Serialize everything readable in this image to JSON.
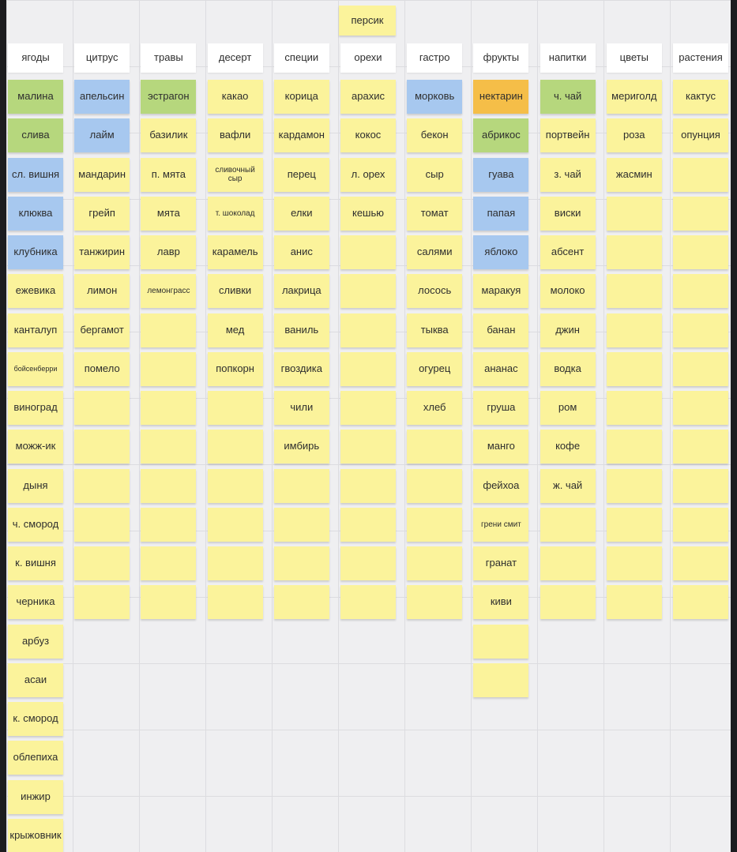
{
  "colors": {
    "yellow": "#fbf39b",
    "green": "#b6d77d",
    "blue": "#a7c8ef",
    "orange": "#f5be48",
    "header": "#ffffff"
  },
  "title": "персик",
  "columns": [
    {
      "header": "ягоды",
      "notes": [
        {
          "t": "малина",
          "c": "green"
        },
        {
          "t": "слива",
          "c": "green"
        },
        {
          "t": "сл. вишня",
          "c": "blue"
        },
        {
          "t": "клюква",
          "c": "blue"
        },
        {
          "t": "клубника",
          "c": "blue"
        },
        {
          "t": "ежевика",
          "c": "yellow"
        },
        {
          "t": "канталуп",
          "c": "yellow"
        },
        {
          "t": "бойсенберри",
          "c": "yellow"
        },
        {
          "t": "виноград",
          "c": "yellow"
        },
        {
          "t": "можж-ик",
          "c": "yellow"
        },
        {
          "t": "дыня",
          "c": "yellow"
        },
        {
          "t": "ч. смород",
          "c": "yellow"
        },
        {
          "t": "к. вишня",
          "c": "yellow"
        },
        {
          "t": "черника",
          "c": "yellow"
        },
        {
          "t": "арбуз",
          "c": "yellow"
        },
        {
          "t": "асаи",
          "c": "yellow"
        },
        {
          "t": "к. смород",
          "c": "yellow"
        },
        {
          "t": "облепиха",
          "c": "yellow"
        },
        {
          "t": "инжир",
          "c": "yellow"
        },
        {
          "t": "крыжовник",
          "c": "yellow"
        }
      ]
    },
    {
      "header": "цитрус",
      "notes": [
        {
          "t": "апельсин",
          "c": "blue"
        },
        {
          "t": "лайм",
          "c": "blue"
        },
        {
          "t": "мандарин",
          "c": "yellow"
        },
        {
          "t": "грейп",
          "c": "yellow"
        },
        {
          "t": "танжирин",
          "c": "yellow"
        },
        {
          "t": "лимон",
          "c": "yellow"
        },
        {
          "t": "бергамот",
          "c": "yellow"
        },
        {
          "t": "помело",
          "c": "yellow"
        },
        {
          "t": "",
          "c": "yellow"
        },
        {
          "t": "",
          "c": "yellow"
        },
        {
          "t": "",
          "c": "yellow"
        },
        {
          "t": "",
          "c": "yellow"
        },
        {
          "t": "",
          "c": "yellow"
        },
        {
          "t": "",
          "c": "yellow"
        }
      ]
    },
    {
      "header": "травы",
      "notes": [
        {
          "t": "эстрагон",
          "c": "green"
        },
        {
          "t": "базилик",
          "c": "yellow"
        },
        {
          "t": "п. мята",
          "c": "yellow"
        },
        {
          "t": "мята",
          "c": "yellow"
        },
        {
          "t": "лавр",
          "c": "yellow"
        },
        {
          "t": "лемонграсс",
          "c": "yellow"
        },
        {
          "t": "",
          "c": "yellow"
        },
        {
          "t": "",
          "c": "yellow"
        },
        {
          "t": "",
          "c": "yellow"
        },
        {
          "t": "",
          "c": "yellow"
        },
        {
          "t": "",
          "c": "yellow"
        },
        {
          "t": "",
          "c": "yellow"
        },
        {
          "t": "",
          "c": "yellow"
        },
        {
          "t": "",
          "c": "yellow"
        }
      ]
    },
    {
      "header": "десерт",
      "notes": [
        {
          "t": "какао",
          "c": "yellow"
        },
        {
          "t": "вафли",
          "c": "yellow"
        },
        {
          "t": "сливочный сыр",
          "c": "yellow"
        },
        {
          "t": "т. шоколад",
          "c": "yellow"
        },
        {
          "t": "карамель",
          "c": "yellow"
        },
        {
          "t": "сливки",
          "c": "yellow"
        },
        {
          "t": "мед",
          "c": "yellow"
        },
        {
          "t": "попкорн",
          "c": "yellow"
        },
        {
          "t": "",
          "c": "yellow"
        },
        {
          "t": "",
          "c": "yellow"
        },
        {
          "t": "",
          "c": "yellow"
        },
        {
          "t": "",
          "c": "yellow"
        },
        {
          "t": "",
          "c": "yellow"
        },
        {
          "t": "",
          "c": "yellow"
        }
      ]
    },
    {
      "header": "специи",
      "notes": [
        {
          "t": "корица",
          "c": "yellow"
        },
        {
          "t": "кардамон",
          "c": "yellow"
        },
        {
          "t": "перец",
          "c": "yellow"
        },
        {
          "t": "елки",
          "c": "yellow"
        },
        {
          "t": "анис",
          "c": "yellow"
        },
        {
          "t": "лакрица",
          "c": "yellow"
        },
        {
          "t": "ваниль",
          "c": "yellow"
        },
        {
          "t": "гвоздика",
          "c": "yellow"
        },
        {
          "t": "чили",
          "c": "yellow"
        },
        {
          "t": "имбирь",
          "c": "yellow"
        },
        {
          "t": "",
          "c": "yellow"
        },
        {
          "t": "",
          "c": "yellow"
        },
        {
          "t": "",
          "c": "yellow"
        },
        {
          "t": "",
          "c": "yellow"
        }
      ]
    },
    {
      "header": "орехи",
      "notes": [
        {
          "t": "арахис",
          "c": "yellow"
        },
        {
          "t": "кокос",
          "c": "yellow"
        },
        {
          "t": "л. орех",
          "c": "yellow"
        },
        {
          "t": "кешью",
          "c": "yellow"
        },
        {
          "t": "",
          "c": "yellow"
        },
        {
          "t": "",
          "c": "yellow"
        },
        {
          "t": "",
          "c": "yellow"
        },
        {
          "t": "",
          "c": "yellow"
        },
        {
          "t": "",
          "c": "yellow"
        },
        {
          "t": "",
          "c": "yellow"
        },
        {
          "t": "",
          "c": "yellow"
        },
        {
          "t": "",
          "c": "yellow"
        },
        {
          "t": "",
          "c": "yellow"
        },
        {
          "t": "",
          "c": "yellow"
        }
      ]
    },
    {
      "header": "гастро",
      "notes": [
        {
          "t": "морковь",
          "c": "blue"
        },
        {
          "t": "бекон",
          "c": "yellow"
        },
        {
          "t": "сыр",
          "c": "yellow"
        },
        {
          "t": "томат",
          "c": "yellow"
        },
        {
          "t": "салями",
          "c": "yellow"
        },
        {
          "t": "лосось",
          "c": "yellow"
        },
        {
          "t": "тыква",
          "c": "yellow"
        },
        {
          "t": "огурец",
          "c": "yellow"
        },
        {
          "t": "хлеб",
          "c": "yellow"
        },
        {
          "t": "",
          "c": "yellow"
        },
        {
          "t": "",
          "c": "yellow"
        },
        {
          "t": "",
          "c": "yellow"
        },
        {
          "t": "",
          "c": "yellow"
        },
        {
          "t": "",
          "c": "yellow"
        }
      ]
    },
    {
      "header": "фрукты",
      "notes": [
        {
          "t": "нектарин",
          "c": "orange"
        },
        {
          "t": "абрикос",
          "c": "green"
        },
        {
          "t": "гуава",
          "c": "blue"
        },
        {
          "t": "папая",
          "c": "blue"
        },
        {
          "t": "яблоко",
          "c": "blue"
        },
        {
          "t": "маракуя",
          "c": "yellow"
        },
        {
          "t": "банан",
          "c": "yellow"
        },
        {
          "t": "ананас",
          "c": "yellow"
        },
        {
          "t": "груша",
          "c": "yellow"
        },
        {
          "t": "манго",
          "c": "yellow"
        },
        {
          "t": "фейхоа",
          "c": "yellow"
        },
        {
          "t": "грени смит",
          "c": "yellow"
        },
        {
          "t": "гранат",
          "c": "yellow"
        },
        {
          "t": "киви",
          "c": "yellow"
        },
        {
          "t": "",
          "c": "yellow"
        },
        {
          "t": "",
          "c": "yellow"
        }
      ]
    },
    {
      "header": "напитки",
      "notes": [
        {
          "t": "ч. чай",
          "c": "green"
        },
        {
          "t": "портвейн",
          "c": "yellow"
        },
        {
          "t": "з. чай",
          "c": "yellow"
        },
        {
          "t": "виски",
          "c": "yellow"
        },
        {
          "t": "абсент",
          "c": "yellow"
        },
        {
          "t": "молоко",
          "c": "yellow"
        },
        {
          "t": "джин",
          "c": "yellow"
        },
        {
          "t": "водка",
          "c": "yellow"
        },
        {
          "t": "ром",
          "c": "yellow"
        },
        {
          "t": "кофе",
          "c": "yellow"
        },
        {
          "t": "ж. чай",
          "c": "yellow"
        },
        {
          "t": "",
          "c": "yellow"
        },
        {
          "t": "",
          "c": "yellow"
        },
        {
          "t": "",
          "c": "yellow"
        }
      ]
    },
    {
      "header": "цветы",
      "notes": [
        {
          "t": "мериголд",
          "c": "yellow"
        },
        {
          "t": "роза",
          "c": "yellow"
        },
        {
          "t": "жасмин",
          "c": "yellow"
        },
        {
          "t": "",
          "c": "yellow"
        },
        {
          "t": "",
          "c": "yellow"
        },
        {
          "t": "",
          "c": "yellow"
        },
        {
          "t": "",
          "c": "yellow"
        },
        {
          "t": "",
          "c": "yellow"
        },
        {
          "t": "",
          "c": "yellow"
        },
        {
          "t": "",
          "c": "yellow"
        },
        {
          "t": "",
          "c": "yellow"
        },
        {
          "t": "",
          "c": "yellow"
        },
        {
          "t": "",
          "c": "yellow"
        },
        {
          "t": "",
          "c": "yellow"
        }
      ]
    },
    {
      "header": "растения",
      "notes": [
        {
          "t": "кактус",
          "c": "yellow"
        },
        {
          "t": "опунция",
          "c": "yellow"
        },
        {
          "t": "",
          "c": "yellow"
        },
        {
          "t": "",
          "c": "yellow"
        },
        {
          "t": "",
          "c": "yellow"
        },
        {
          "t": "",
          "c": "yellow"
        },
        {
          "t": "",
          "c": "yellow"
        },
        {
          "t": "",
          "c": "yellow"
        },
        {
          "t": "",
          "c": "yellow"
        },
        {
          "t": "",
          "c": "yellow"
        },
        {
          "t": "",
          "c": "yellow"
        },
        {
          "t": "",
          "c": "yellow"
        },
        {
          "t": "",
          "c": "yellow"
        },
        {
          "t": "",
          "c": "yellow"
        }
      ]
    }
  ]
}
